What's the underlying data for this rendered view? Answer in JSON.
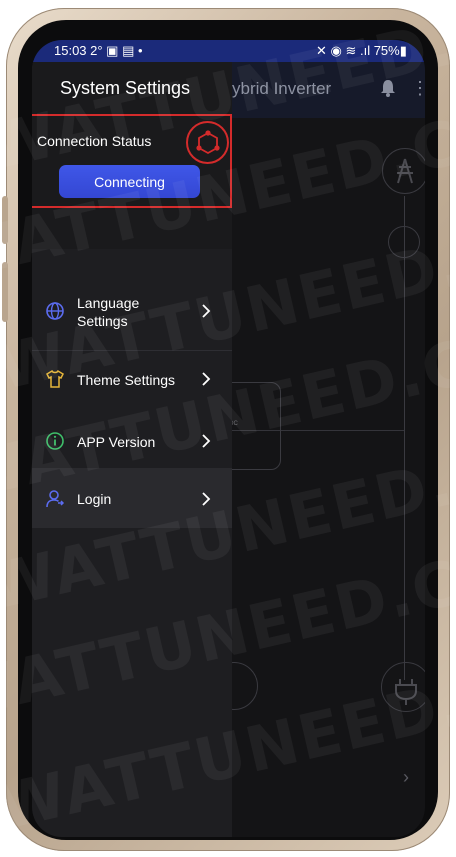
{
  "status_bar": {
    "left": "15:03 2° ▣ ▤ •",
    "right": "✕ ◉ ≋ .ıl 75%▮"
  },
  "background": {
    "title": "ybrid Inverter",
    "box_label": "= DC"
  },
  "drawer": {
    "title": "System Settings",
    "connection_label": "Connection Status",
    "connect_button": "Connecting",
    "items": [
      {
        "label": "Language\nSettings",
        "icon": "globe-icon"
      },
      {
        "label": "Theme Settings",
        "icon": "tshirt-icon"
      },
      {
        "label": "APP Version",
        "icon": "info-icon"
      },
      {
        "label": "Login",
        "icon": "user-icon"
      }
    ]
  },
  "watermark": "WATTUNEED.COM",
  "colors": {
    "accent": "#3f57e8",
    "highlight": "#d42b2b",
    "connection_icon": "#d42b2b",
    "drawer_bg": "#1e1e21",
    "statusbar_bg": "#1b2a7a"
  }
}
